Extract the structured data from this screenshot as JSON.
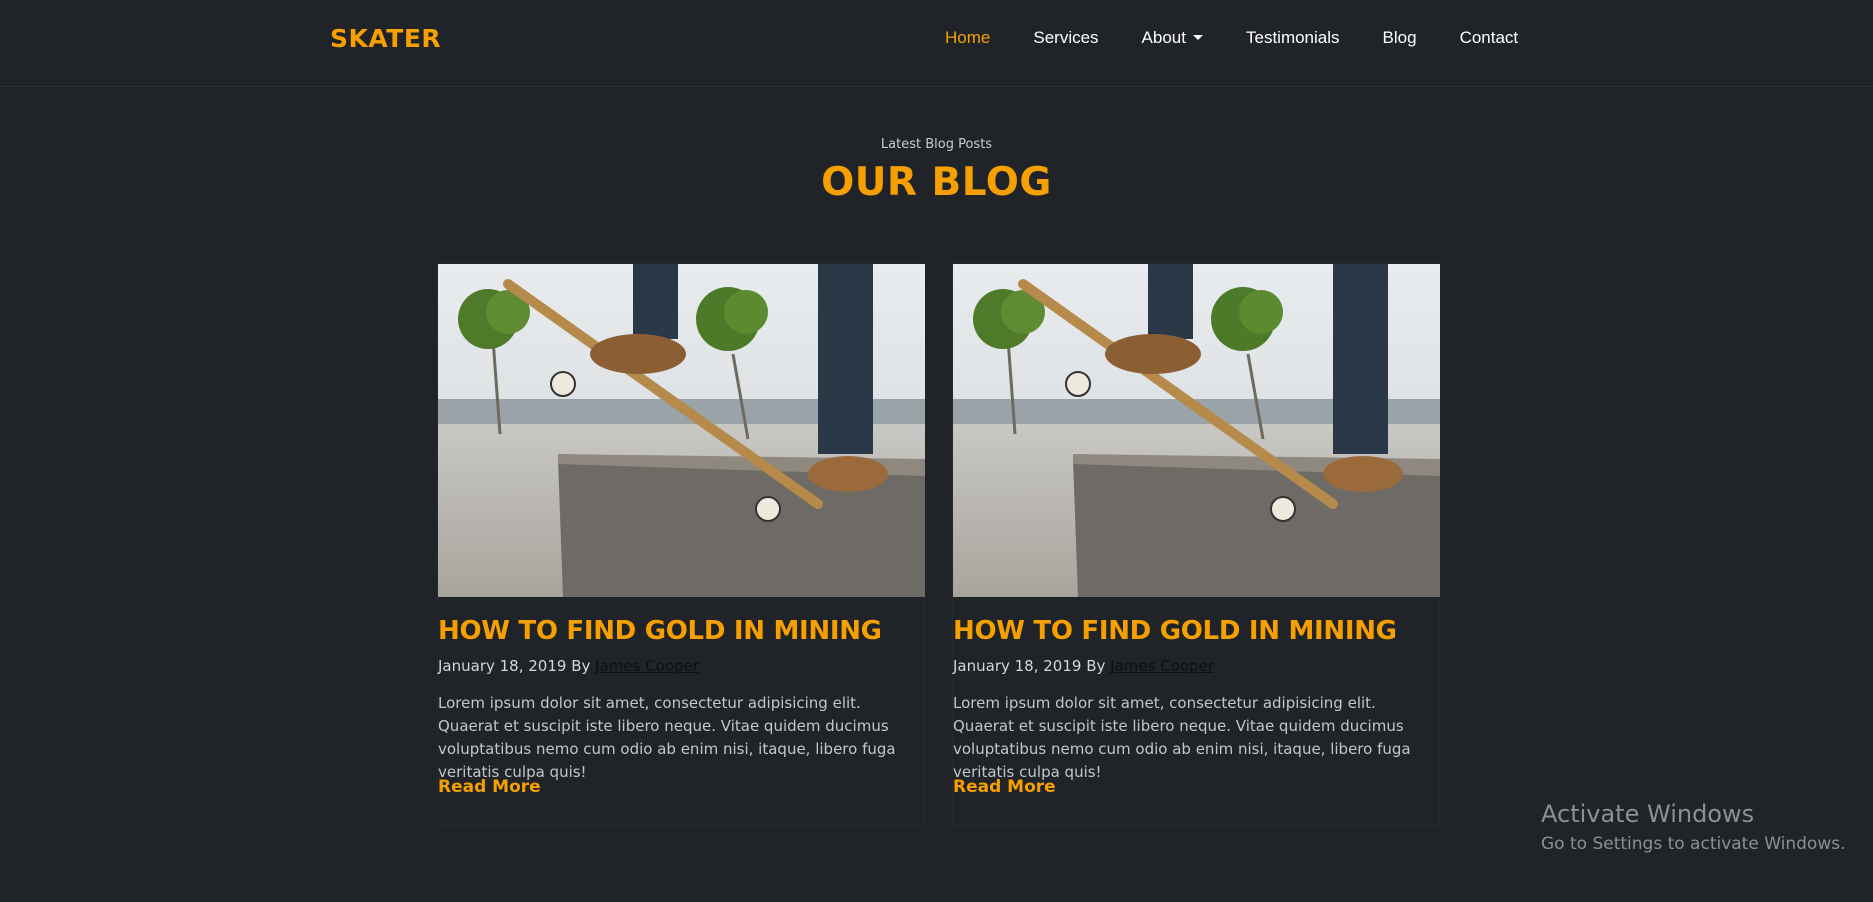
{
  "navbar": {
    "brand": "SKATER",
    "items": [
      {
        "label": "Home",
        "active": true
      },
      {
        "label": "Services",
        "active": false
      },
      {
        "label": "About",
        "active": false,
        "dropdown": true
      },
      {
        "label": "Testimonials",
        "active": false
      },
      {
        "label": "Blog",
        "active": false
      },
      {
        "label": "Contact",
        "active": false
      }
    ]
  },
  "section": {
    "eyebrow": "Latest Blog Posts",
    "title": "OUR BLOG"
  },
  "posts": [
    {
      "title": "HOW TO FIND GOLD IN MINING",
      "date_prefix": "January 18, 2019 By ",
      "author": "James Cooper",
      "excerpt": "Lorem ipsum dolor sit amet, consectetur adipisicing elit. Quaerat et suscipit iste libero neque. Vitae quidem ducimus voluptatibus nemo cum odio ab enim nisi, itaque, libero fuga veritatis culpa quis!",
      "read_more": "Read More"
    },
    {
      "title": "HOW TO FIND GOLD IN MINING",
      "date_prefix": "January 18, 2019 By ",
      "author": "James Cooper",
      "excerpt": "Lorem ipsum dolor sit amet, consectetur adipisicing elit. Quaerat et suscipit iste libero neque. Vitae quidem ducimus voluptatibus nemo cum odio ab enim nisi, itaque, libero fuga veritatis culpa quis!",
      "read_more": "Read More"
    }
  ],
  "watermark": {
    "title": "Activate Windows",
    "subtitle": "Go to Settings to activate Windows."
  },
  "colors": {
    "background": "#202327",
    "accent": "#f5a000",
    "text": "#ffffff"
  }
}
